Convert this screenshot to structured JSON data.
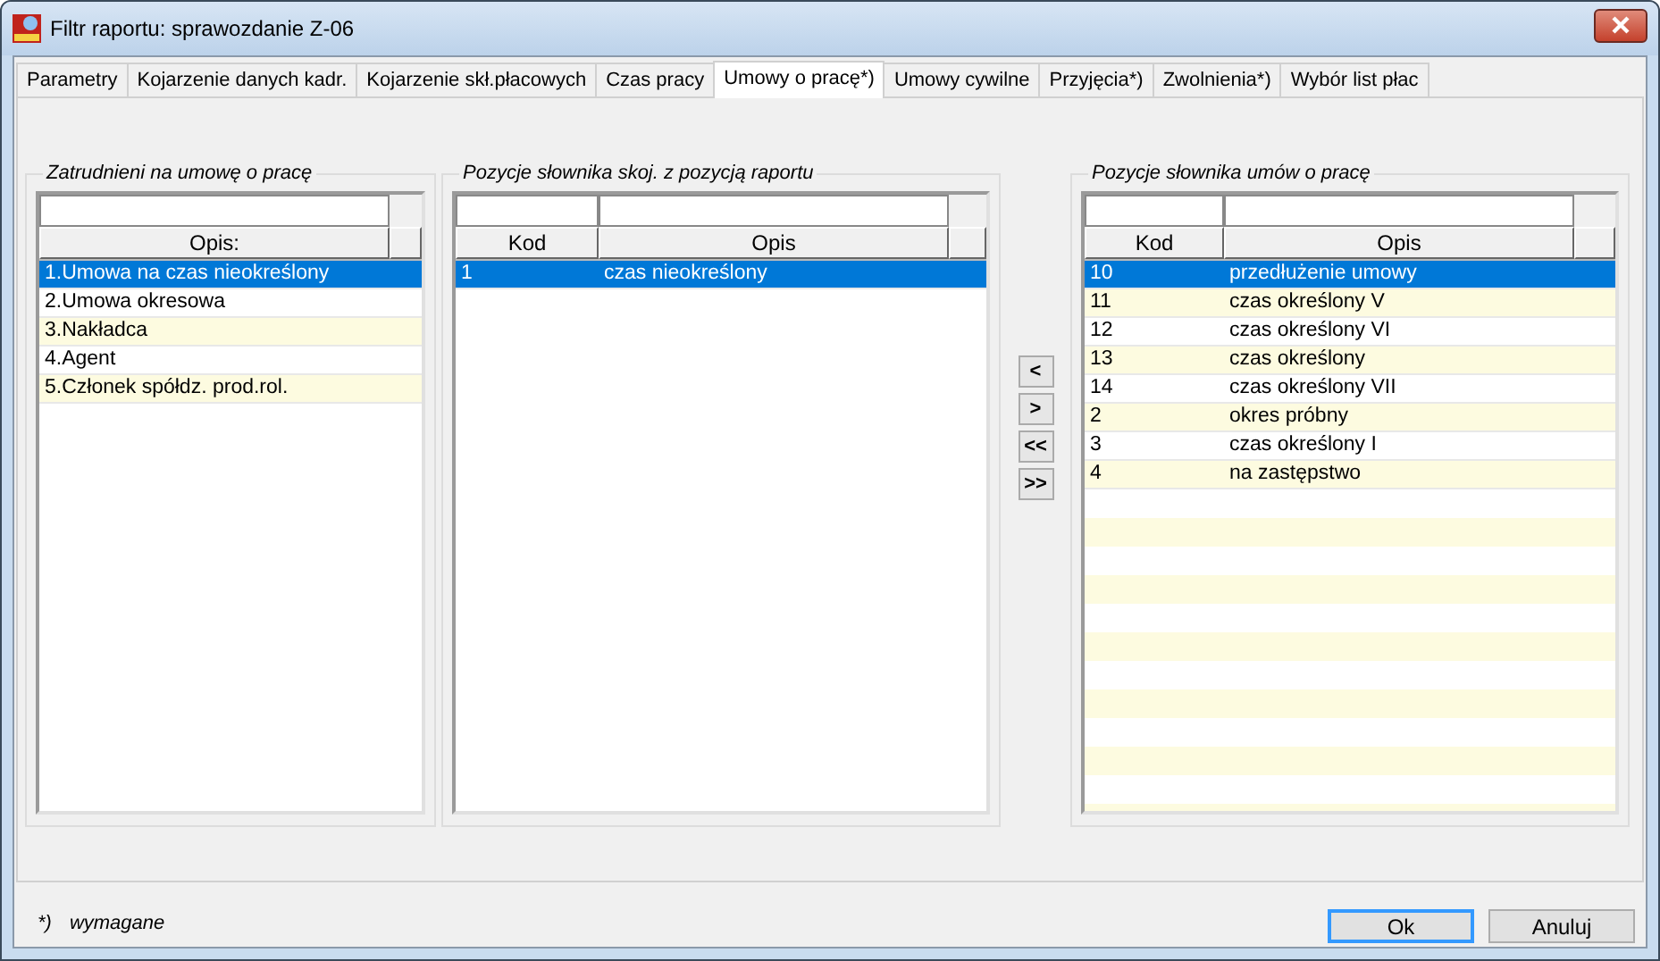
{
  "window": {
    "title": "Filtr raportu: sprawozdanie Z-06"
  },
  "tabs": [
    {
      "label": "Parametry",
      "selected": false
    },
    {
      "label": "Kojarzenie danych kadr.",
      "selected": false
    },
    {
      "label": "Kojarzenie skł.płacowych",
      "selected": false
    },
    {
      "label": "Czas pracy",
      "selected": false
    },
    {
      "label": "Umowy o pracę*)",
      "selected": true
    },
    {
      "label": "Umowy cywilne",
      "selected": false
    },
    {
      "label": "Przyjęcia*)",
      "selected": false
    },
    {
      "label": "Zwolnienia*)",
      "selected": false
    },
    {
      "label": "Wybór list płac",
      "selected": false
    }
  ],
  "panels": [
    {
      "title": "Zatrudnieni na umowę o pracę",
      "columns": [
        "Opis:"
      ],
      "rows": [
        {
          "cells": [
            "1.Umowa na czas nieokreślony"
          ],
          "selected": true
        },
        {
          "cells": [
            "2.Umowa okresowa"
          ],
          "selected": false
        },
        {
          "cells": [
            "3.Nakładca"
          ],
          "selected": false
        },
        {
          "cells": [
            "4.Agent"
          ],
          "selected": false
        },
        {
          "cells": [
            "5.Członek spółdz. prod.rol."
          ],
          "selected": false
        }
      ]
    },
    {
      "title": "Pozycje słownika skoj. z pozycją raportu",
      "columns": [
        "Kod",
        "Opis"
      ],
      "rows": [
        {
          "cells": [
            "1",
            "czas nieokreślony"
          ],
          "selected": true
        }
      ]
    },
    {
      "title": "Pozycje słownika umów o pracę",
      "columns": [
        "Kod",
        "Opis"
      ],
      "rows": [
        {
          "cells": [
            "10",
            "przedłużenie umowy"
          ],
          "selected": true
        },
        {
          "cells": [
            "11",
            "czas określony V"
          ],
          "selected": false
        },
        {
          "cells": [
            "12",
            "czas określony VI"
          ],
          "selected": false
        },
        {
          "cells": [
            "13",
            "czas określony"
          ],
          "selected": false
        },
        {
          "cells": [
            "14",
            "czas określony VII"
          ],
          "selected": false
        },
        {
          "cells": [
            "2",
            "okres próbny"
          ],
          "selected": false
        },
        {
          "cells": [
            "3",
            "czas określony I"
          ],
          "selected": false
        },
        {
          "cells": [
            "4",
            "na zastępstwo"
          ],
          "selected": false
        }
      ]
    }
  ],
  "move_buttons": [
    "<",
    ">",
    "<<",
    ">>"
  ],
  "footnote": {
    "mark": "*)",
    "text": "wymagane"
  },
  "buttons": [
    {
      "label": "Ok",
      "focused": true
    },
    {
      "label": "Anuluj",
      "focused": false
    }
  ]
}
